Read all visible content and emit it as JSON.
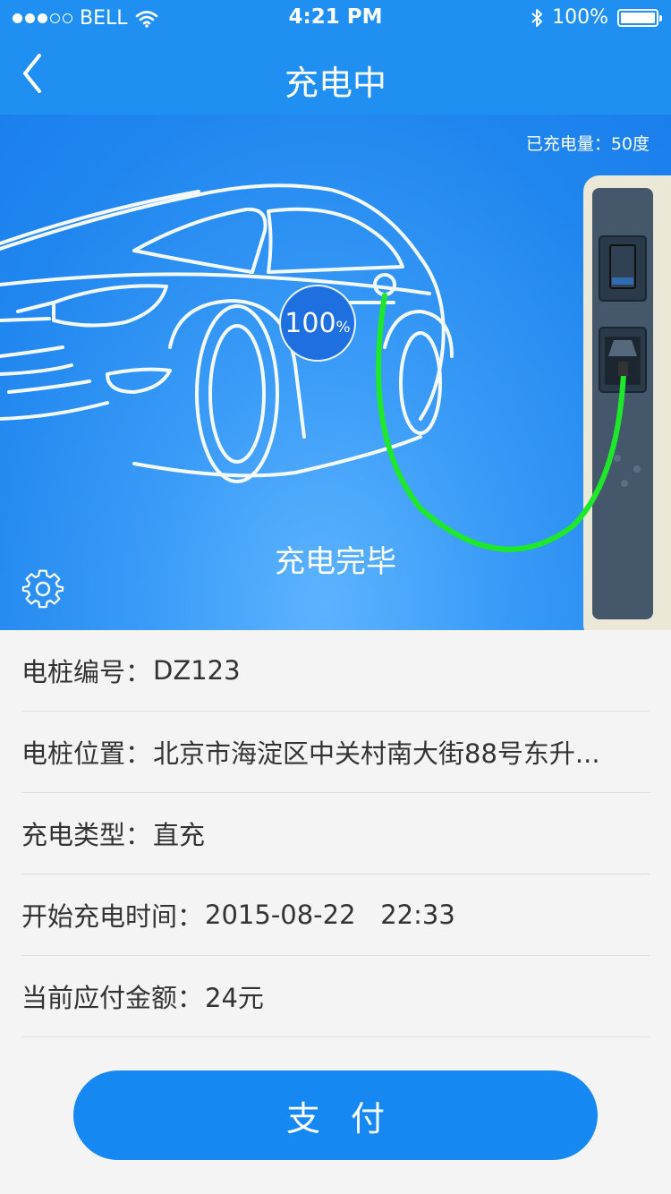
{
  "status_bar": {
    "carrier": "BELL",
    "time": "4:21 PM",
    "battery": "100%"
  },
  "nav": {
    "title": "充电中"
  },
  "hero": {
    "charged_amount": "已充电量：50度",
    "percent_value": "100",
    "percent_unit": "%",
    "status": "充电完毕"
  },
  "info": {
    "rows": [
      {
        "label": "电桩编号：",
        "value": "DZ123"
      },
      {
        "label": "电桩位置：",
        "value": "北京市海淀区中关村南大街88号东升..."
      },
      {
        "label": "充电类型：",
        "value": "直充"
      },
      {
        "label": "开始充电时间：",
        "value": "2015-08-22   22:33"
      },
      {
        "label": "当前应付金额：",
        "value": "24元"
      }
    ]
  },
  "pay_button": {
    "label": "支付"
  },
  "colors": {
    "brand_blue": "#1f8ff2",
    "cable_green": "#1de82a",
    "station_body": "#ece8d8"
  }
}
